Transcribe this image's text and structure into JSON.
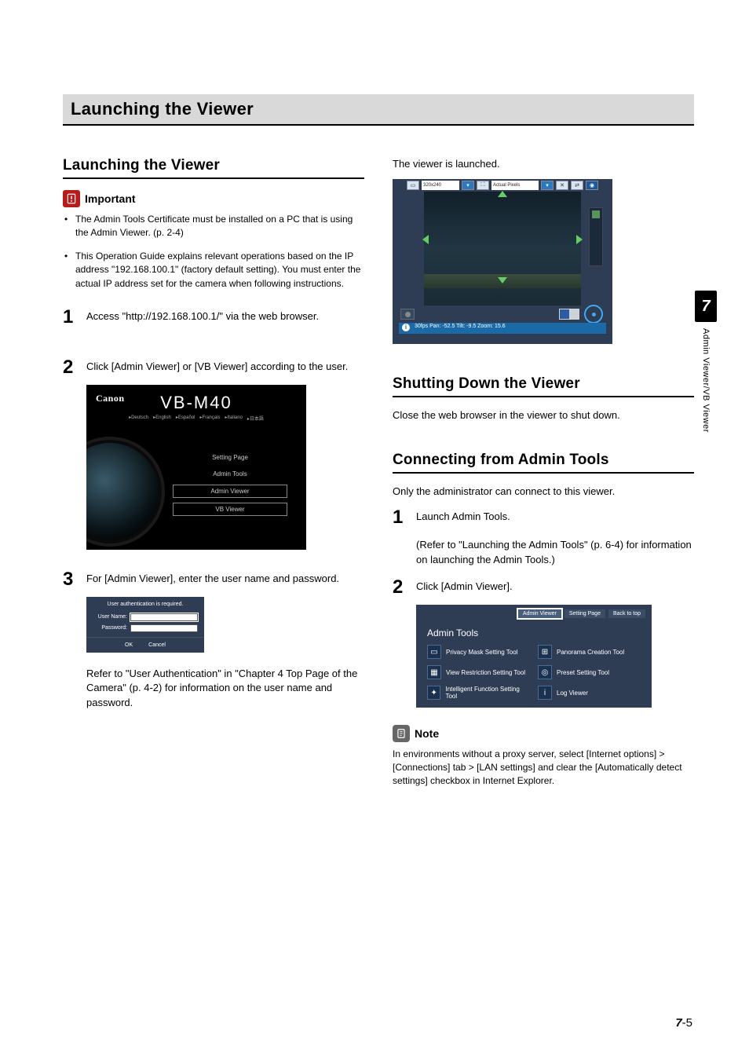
{
  "page": {
    "chapter_number": "7",
    "side_label": "Admin Viewer/VB Viewer",
    "footer_chapter": "7",
    "footer_sep": "-",
    "footer_page": "5"
  },
  "main_heading": "Launching the Viewer",
  "left": {
    "heading": "Launching the Viewer",
    "important_label": "Important",
    "important_bullets": [
      "The Admin Tools Certificate must be installed on a PC that is using the Admin Viewer. (p. 2-4)",
      "This Operation Guide explains relevant operations based on the IP address \"192.168.100.1\" (factory default setting). You must enter the actual IP address set for the camera when following instructions."
    ],
    "steps": [
      {
        "n": "1",
        "text": "Access \"http://192.168.100.1/\" via the web browser."
      },
      {
        "n": "2",
        "text": "Click [Admin Viewer] or [VB Viewer] according to the user."
      },
      {
        "n": "3",
        "text": "For [Admin Viewer], enter the user name and password."
      }
    ],
    "step3_note": "Refer to \"User Authentication\" in \"Chapter 4 Top Page of the Camera\" (p. 4-2) for information on the user name and password.",
    "toppage": {
      "logo": "Canon",
      "model": "VB-M40",
      "langs": [
        "▸Deutsch",
        "▸English",
        "▸Español",
        "▸Français",
        "▸Italiano",
        "▸日本語"
      ],
      "buttons": [
        "Setting Page",
        "Admin Tools",
        "Admin Viewer",
        "VB Viewer"
      ]
    },
    "auth": {
      "msg": "User authentication is required.",
      "user_label": "User Name:",
      "pass_label": "Password:",
      "ok": "OK",
      "cancel": "Cancel"
    }
  },
  "right": {
    "launched_text": "The viewer is launched.",
    "viewer_toolbar": {
      "size_sel": "320x240",
      "pixels_sel": "Actual Pixels"
    },
    "viewer_status": "30fps Pan: -52.5 Tilt: -9.5 Zoom: 15.6",
    "shutdown": {
      "heading": "Shutting Down the Viewer",
      "text": "Close the web browser in the viewer to shut down."
    },
    "connect": {
      "heading": "Connecting from Admin Tools",
      "intro": "Only the administrator can connect to this viewer.",
      "steps": [
        {
          "n": "1",
          "text": "Launch Admin Tools.",
          "note": "(Refer to \"Launching the Admin Tools\" (p. 6-4) for information on launching the Admin Tools.)"
        },
        {
          "n": "2",
          "text": "Click [Admin Viewer]."
        }
      ]
    },
    "admin_tools": {
      "top_buttons": [
        "Admin Viewer",
        "Setting Page",
        "Back to top"
      ],
      "title": "Admin Tools",
      "items": [
        "Privacy Mask Setting Tool",
        "Panorama Creation Tool",
        "View Restriction Setting Tool",
        "Preset Setting Tool",
        "Intelligent Function Setting Tool",
        "Log Viewer"
      ]
    },
    "note_label": "Note",
    "note_text": "In environments without a proxy server, select [Internet options] > [Connections] tab > [LAN settings] and clear the [Automatically detect settings] checkbox in Internet Explorer."
  }
}
